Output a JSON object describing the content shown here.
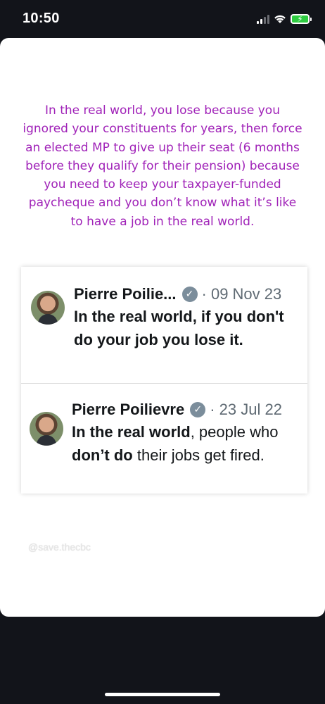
{
  "status_bar": {
    "time": "10:50",
    "signal_bars": 4,
    "signal_active": 2,
    "battery_state": "charging",
    "battery_color": "#2ecc40"
  },
  "caption": {
    "text": "In the real world, you lose because you ignored your constituents for years, then force an elected MP to give up their seat (6 months before they qualify for their pension)  because you need to keep your taxpayer-funded paycheque and you don’t know what it’s like to have a job in the real world.",
    "color": "#a022b8"
  },
  "tweets": [
    {
      "name": "Pierre Poilie...",
      "verified_icon": "verified-badge-icon",
      "date": "· 09 Nov 23",
      "body": "In the real world, if you don't do your job you lose it."
    },
    {
      "name": "Pierre Poilievre",
      "verified_icon": "verified-badge-icon",
      "date": "· 23 Jul 22",
      "body_parts": [
        "In the real world",
        ", people who ",
        "don’t do",
        " their jobs get fired."
      ]
    }
  ],
  "watermark": "@save.thecbc"
}
